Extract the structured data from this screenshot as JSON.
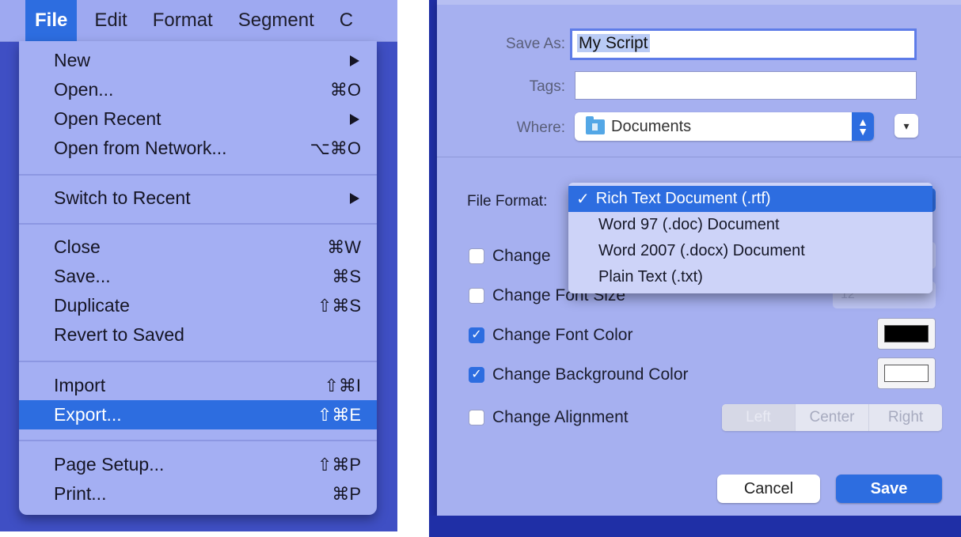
{
  "menubar": {
    "items": [
      "File",
      "Edit",
      "Format",
      "Segment"
    ],
    "truncated": "C"
  },
  "file_menu": {
    "items": [
      {
        "label": "New",
        "shortcut": "",
        "submenu": true
      },
      {
        "label": "Open...",
        "shortcut": "⌘O",
        "submenu": false
      },
      {
        "label": "Open Recent",
        "shortcut": "",
        "submenu": true
      },
      {
        "label": "Open from Network...",
        "shortcut": "⌥⌘O",
        "submenu": false
      },
      {
        "label": "Switch to Recent",
        "shortcut": "",
        "submenu": true
      },
      {
        "label": "Close",
        "shortcut": "⌘W",
        "submenu": false
      },
      {
        "label": "Save...",
        "shortcut": "⌘S",
        "submenu": false
      },
      {
        "label": "Duplicate",
        "shortcut": "⇧⌘S",
        "submenu": false
      },
      {
        "label": "Revert to Saved",
        "shortcut": "",
        "submenu": false
      },
      {
        "label": "Import",
        "shortcut": "⇧⌘I",
        "submenu": false
      },
      {
        "label": "Export...",
        "shortcut": "⇧⌘E",
        "submenu": false,
        "selected": true
      },
      {
        "label": "Page Setup...",
        "shortcut": "⇧⌘P",
        "submenu": false
      },
      {
        "label": "Print...",
        "shortcut": "⌘P",
        "submenu": false
      }
    ]
  },
  "dialog": {
    "save_as_label": "Save As:",
    "save_as_value": "My Script",
    "tags_label": "Tags:",
    "tags_value": "",
    "where_label": "Where:",
    "where_value": "Documents",
    "file_format_label": "File Format:",
    "file_format_options": [
      {
        "label": "Rich Text Document (.rtf)",
        "selected": true
      },
      {
        "label": "Word 97 (.doc) Document",
        "selected": false
      },
      {
        "label": "Word 2007 (.docx) Document",
        "selected": false
      },
      {
        "label": "Plain Text (.txt)",
        "selected": false
      }
    ],
    "options": [
      {
        "label": "Change Font",
        "checked": false,
        "visible_text": "Change "
      },
      {
        "label": "Change Font Size",
        "checked": false,
        "visible_text": "Change Font Size",
        "value": "12"
      },
      {
        "label": "Change Font Color",
        "checked": true,
        "color": "#000000"
      },
      {
        "label": "Change Background Color",
        "checked": true,
        "color": "#ffffff"
      },
      {
        "label": "Change Alignment",
        "checked": false
      }
    ],
    "alignment_options": [
      "Left",
      "Center",
      "Right"
    ],
    "cancel_label": "Cancel",
    "save_label": "Save"
  },
  "colors": {
    "accent": "#2d6de0",
    "menu_bg": "#a4aff3",
    "dialog_bg": "#a6b0f0",
    "backdrop": "#1f2fa6",
    "backdrop_text_red": "#e8433a"
  }
}
